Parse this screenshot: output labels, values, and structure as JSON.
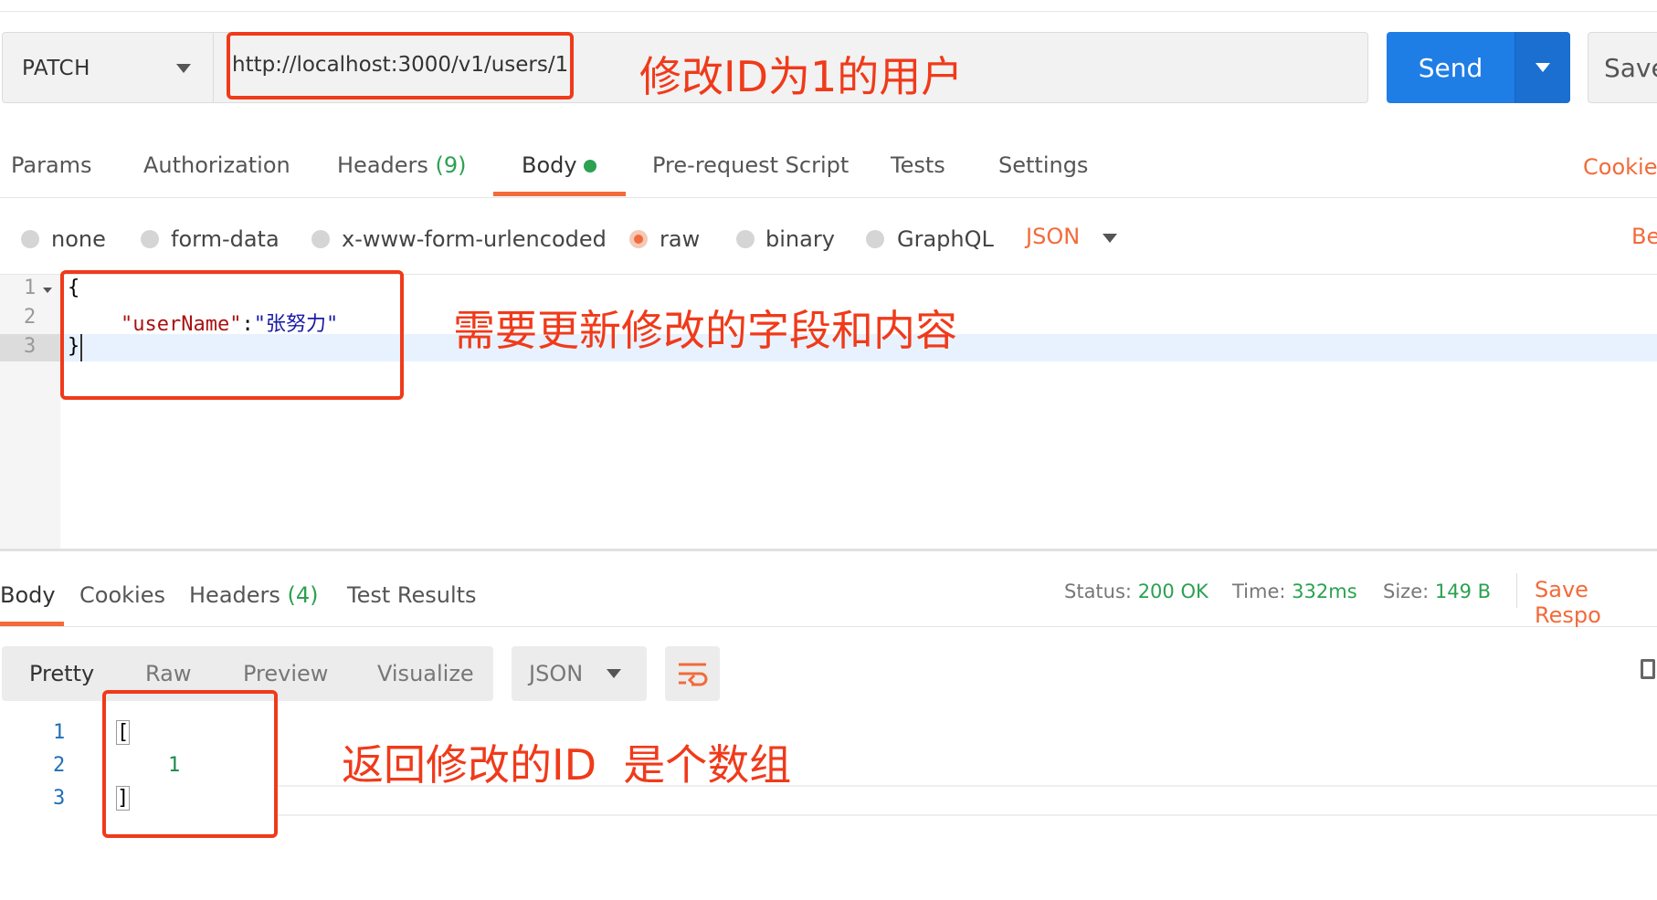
{
  "request": {
    "method": "PATCH",
    "url": "http://localhost:3000/v1/users/1",
    "send_label": "Send",
    "save_label": "Save"
  },
  "tabs": {
    "params": "Params",
    "authorization": "Authorization",
    "headers": "Headers",
    "headers_count": "(9)",
    "body": "Body",
    "pre_request": "Pre-request Script",
    "tests": "Tests",
    "settings": "Settings",
    "cookies": "Cookies"
  },
  "body_types": {
    "none": "none",
    "form_data": "form-data",
    "urlencoded": "x-www-form-urlencoded",
    "raw": "raw",
    "binary": "binary",
    "graphql": "GraphQL",
    "format": "JSON",
    "beautify": "Be"
  },
  "editor": {
    "line_numbers": [
      "1",
      "2",
      "3"
    ],
    "line1": "{",
    "key": "\"userName\"",
    "colon": ":",
    "value": "\"张努力\"",
    "line3": "}"
  },
  "response": {
    "tabs": {
      "body": "Body",
      "cookies": "Cookies",
      "headers": "Headers",
      "headers_count": "(4)",
      "test_results": "Test Results"
    },
    "status_label": "Status:",
    "status_value": "200 OK",
    "time_label": "Time:",
    "time_value": "332ms",
    "size_label": "Size:",
    "size_value": "149 B",
    "save_response": "Save Respo",
    "view_modes": {
      "pretty": "Pretty",
      "raw": "Raw",
      "preview": "Preview",
      "visualize": "Visualize"
    },
    "format": "JSON",
    "line_numbers": [
      "1",
      "2",
      "3"
    ],
    "line1": "[",
    "line2": "1",
    "line3": "]"
  },
  "annotations": {
    "url_note": "修改ID为1的用户",
    "body_note": "需要更新修改的字段和内容",
    "response_note": "返回修改的ID  是个数组"
  },
  "colors": {
    "accent": "#f26b3a",
    "send": "#1f7de6",
    "annotation": "#f03a1a",
    "success": "#2ba151"
  }
}
